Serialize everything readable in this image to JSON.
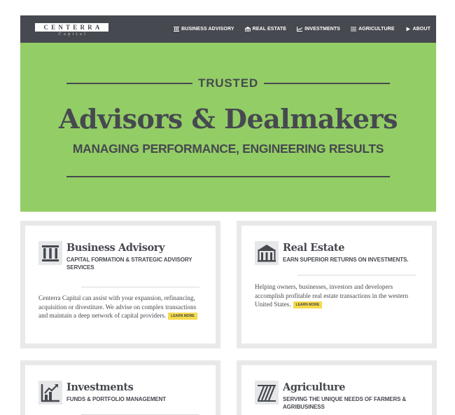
{
  "brand": {
    "name": "CENTERRA",
    "sub": "Capital"
  },
  "nav": {
    "items": [
      {
        "label": "BUSINESS ADVISORY",
        "icon": "columns-icon"
      },
      {
        "label": "REAL ESTATE",
        "icon": "building-icon"
      },
      {
        "label": "INVESTMENTS",
        "icon": "chart-icon"
      },
      {
        "label": "AGRICULTURE",
        "icon": "field-icon"
      },
      {
        "label": "ABOUT",
        "icon": "play-icon"
      }
    ]
  },
  "hero": {
    "eyebrow": "TRUSTED",
    "title": "Advisors & Dealmakers",
    "subtitle": "MANAGING PERFORMANCE, ENGINEERING RESULTS",
    "background": "#93cd65"
  },
  "cards": [
    {
      "title": "Business Advisory",
      "subtitle": "CAPITAL FORMATION & STRATEGIC ADVISORY SERVICES",
      "body": "Centerra Capital can assist with your expansion, refinancing, acquisition or divestiture. We advise on complex transactions and maintain a deep network of capital providers.",
      "cta": "LEARN MORE",
      "icon": "columns-icon"
    },
    {
      "title": "Real Estate",
      "subtitle": "EARN SUPERIOR RETURNS ON INVESTMENTS.",
      "body": "Helping owners, businesses, investors and developers accomplish profitable real estate transactions in the western United States.",
      "cta": "LEARN MORE",
      "icon": "building-icon"
    },
    {
      "title": "Investments",
      "subtitle": "FUNDS & PORTFOLIO MANAGEMENT",
      "icon": "chart-icon"
    },
    {
      "title": "Agriculture",
      "subtitle": "SERVING THE UNIQUE NEEDS OF FARMERS & AGRIBUSINESS",
      "icon": "field-icon"
    }
  ],
  "colors": {
    "dark": "#46494f",
    "accent": "#93cd65",
    "cta": "#f6da4a"
  }
}
